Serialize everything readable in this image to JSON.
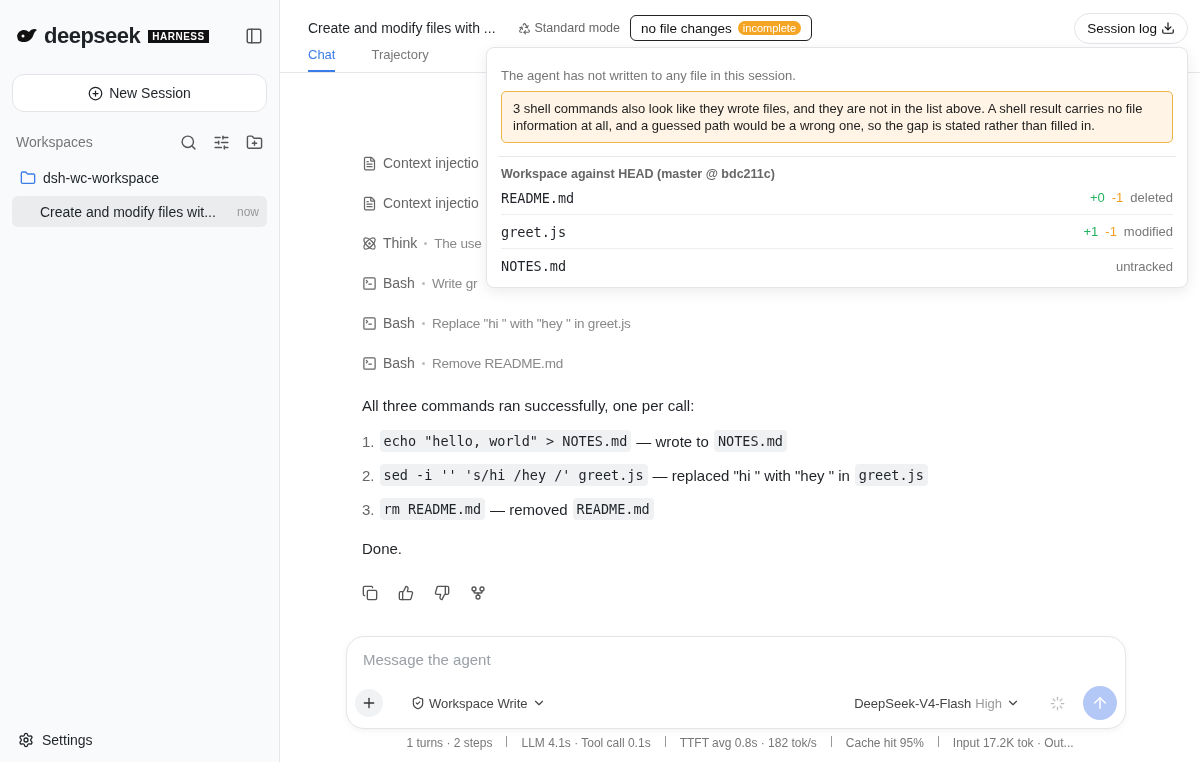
{
  "sidebar": {
    "brand": "deepseek",
    "brand_badge": "HARNESS",
    "new_session": "New Session",
    "workspaces_label": "Workspaces",
    "workspaces": [
      {
        "name": "dsh-wc-workspace",
        "sessions": [
          {
            "title": "Create and modify files wit...",
            "time": "now",
            "selected": true
          }
        ]
      }
    ],
    "settings": "Settings"
  },
  "header": {
    "title": "Create and modify files with ...",
    "mode": "Standard mode",
    "changes": "no file changes",
    "changes_badge": "incomplete",
    "session_log": "Session log"
  },
  "tabs": [
    {
      "label": "Chat",
      "selected": true
    },
    {
      "label": "Trajectory",
      "selected": false
    }
  ],
  "popover": {
    "note": "The agent has not written to any file in this session.",
    "warning": "3 shell commands also look like they wrote files, and they are not in the list above. A shell result carries no file information at all, and a guessed path would be a wrong one, so the gap is stated rather than filled in.",
    "section": "Workspace against HEAD (master @ bdc211c)",
    "files": [
      {
        "name": "README.md",
        "added": "+0",
        "removed": "-1",
        "status": "deleted"
      },
      {
        "name": "greet.js",
        "added": "+1",
        "removed": "-1",
        "status": "modified"
      },
      {
        "name": "NOTES.md",
        "status": "untracked"
      }
    ]
  },
  "steps": [
    {
      "kind": "context",
      "label": "Context injectio"
    },
    {
      "kind": "context",
      "label": "Context injectio"
    },
    {
      "kind": "think",
      "label": "Think",
      "detail": "The use"
    },
    {
      "kind": "bash",
      "label": "Bash",
      "detail": "Write gr"
    },
    {
      "kind": "bash",
      "label": "Bash",
      "detail": "Replace \"hi \" with \"hey \" in greet.js"
    },
    {
      "kind": "bash",
      "label": "Bash",
      "detail": "Remove README.md"
    }
  ],
  "answer": {
    "intro": "All three commands ran successfully, one per call:",
    "items": [
      {
        "number": "1.",
        "parts": [
          {
            "kind": "code",
            "text": "echo \"hello, world\" > NOTES.md"
          },
          {
            "kind": "text",
            "text": "— wrote to"
          },
          {
            "kind": "code",
            "text": "NOTES.md"
          }
        ]
      },
      {
        "number": "2.",
        "parts": [
          {
            "kind": "code",
            "text": "sed -i '' 's/hi /hey /' greet.js"
          },
          {
            "kind": "text",
            "text": "— replaced \"hi \" with \"hey \" in"
          },
          {
            "kind": "code",
            "text": "greet.js"
          }
        ]
      },
      {
        "number": "3.",
        "parts": [
          {
            "kind": "code",
            "text": "rm README.md"
          },
          {
            "kind": "text",
            "text": "— removed"
          },
          {
            "kind": "code",
            "text": "README.md"
          }
        ]
      }
    ],
    "outro": "Done."
  },
  "composer": {
    "placeholder": "Message the agent",
    "permission": "Workspace Write",
    "model": "DeepSeek-V4-Flash",
    "effort": "High"
  },
  "stats": [
    "1 turns · 2 steps",
    "LLM 4.1s · Tool call 0.1s",
    "TTFT avg 0.8s · 182 tok/s",
    "Cache hit 95%",
    "Input 17.2K tok · Out..."
  ]
}
